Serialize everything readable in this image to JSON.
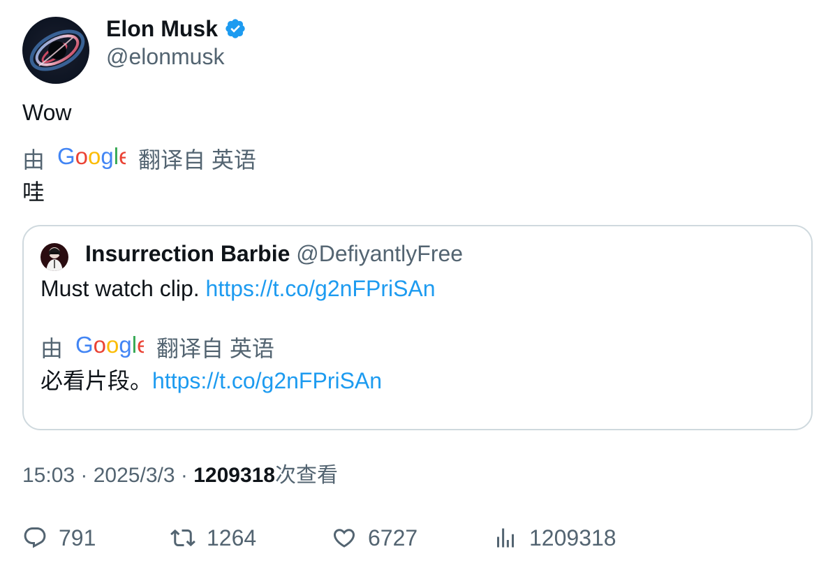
{
  "author": {
    "name": "Elon Musk",
    "handle": "@elonmusk",
    "verified_icon": "verified-badge-icon",
    "verified_color": "#1d9bf0"
  },
  "tweet": {
    "text": "Wow",
    "translate_prefix": "由",
    "translate_provider": "Google",
    "translate_suffix": "翻译自 英语",
    "translated_text": "哇"
  },
  "quote": {
    "name": "Insurrection Barbie",
    "handle": "@DefiyantlyFree",
    "text": "Must watch clip. ",
    "link": "https://t.co/g2nFPriSAn",
    "translate_prefix": "由",
    "translate_provider": "Google",
    "translate_suffix": "翻译自 英语",
    "translated_text": "必看片段。",
    "translated_link": "https://t.co/g2nFPriSAn"
  },
  "meta": {
    "time": "15:03",
    "separator": " · ",
    "date": "2025/3/3",
    "views_count": "1209318",
    "views_label": "次查看"
  },
  "actions": {
    "replies": "791",
    "reposts": "1264",
    "likes": "6727",
    "views": "1209318"
  },
  "colors": {
    "link": "#1d9bf0",
    "secondary": "#536471",
    "primary": "#0f1419",
    "border": "#cfd9de"
  }
}
